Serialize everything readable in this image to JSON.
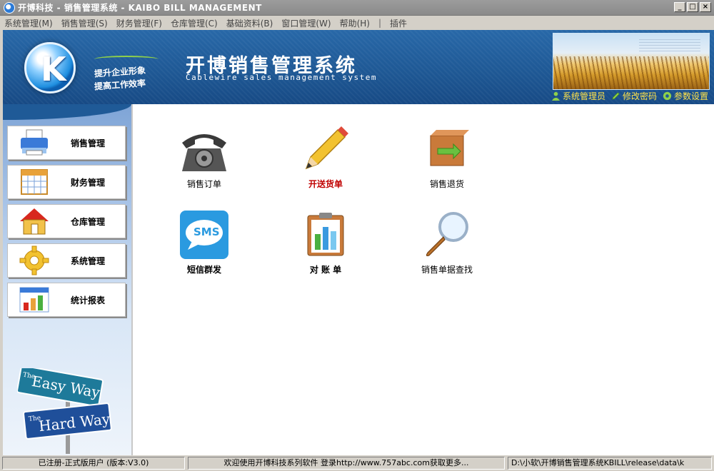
{
  "window": {
    "title": "开博科技 - 销售管理系统 - KAIBO BILL MANAGEMENT",
    "controls": {
      "minimize": "_",
      "maximize": "□",
      "close": "×"
    }
  },
  "menu": {
    "items": [
      "系统管理(M)",
      "销售管理(S)",
      "财务管理(F)",
      "仓库管理(C)",
      "基础资料(B)",
      "窗口管理(W)",
      "帮助(H)"
    ],
    "separator": "|",
    "plugins": "插件"
  },
  "header": {
    "logo_letter": "K",
    "slogan_line1": "提升企业形象",
    "slogan_line2": "提高工作效率",
    "title": "开博销售管理系统",
    "subtitle": "Cablewire sales management system",
    "links": [
      {
        "label": "系统管理员",
        "icon": "user-icon"
      },
      {
        "label": "修改密码",
        "icon": "pencil-icon"
      },
      {
        "label": "参数设置",
        "icon": "settings-icon"
      }
    ]
  },
  "sidebar": {
    "items": [
      {
        "label": "销售管理",
        "icon": "printer-icon"
      },
      {
        "label": "财务管理",
        "icon": "calendar-icon"
      },
      {
        "label": "仓库管理",
        "icon": "house-icon"
      },
      {
        "label": "系统管理",
        "icon": "gear-icon"
      },
      {
        "label": "统计报表",
        "icon": "bar-chart-icon"
      }
    ],
    "signs": {
      "top_small": "The",
      "top_big": "Easy Way",
      "bottom_small": "The",
      "bottom_big": "Hard Way"
    }
  },
  "main": {
    "tiles": [
      {
        "label": "销售订单",
        "icon": "telephone-icon"
      },
      {
        "label": "开送货单",
        "icon": "pencil-icon"
      },
      {
        "label": "销售退货",
        "icon": "return-box-icon"
      },
      {
        "label": "短信群发",
        "icon": "sms-icon",
        "icon_text": "SMS"
      },
      {
        "label": "对 账 单",
        "icon": "clipboard-chart-icon"
      },
      {
        "label": "销售单据查找",
        "icon": "magnifier-icon"
      }
    ]
  },
  "statusbar": {
    "registration": "已注册-正式版用户 (版本:V3.0)",
    "welcome": "欢迎使用开博科技系列软件  登录http://www.757abc.com获取更多...",
    "path": "D:\\小软\\开博销售管理系统KBILL\\release\\data\\k"
  },
  "colors": {
    "header_blue": "#1f5a97",
    "link_yellow": "#ffe24a",
    "highlight_red": "#c00000"
  }
}
